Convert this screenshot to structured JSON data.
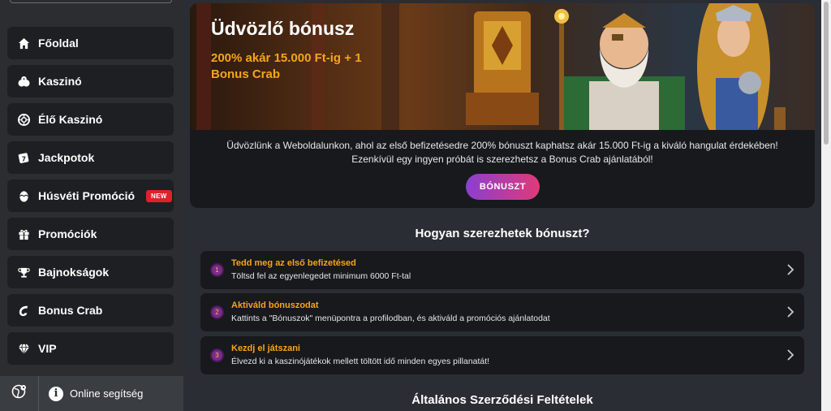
{
  "sidebar": {
    "items": [
      {
        "label": "Főoldal",
        "icon": "home-icon"
      },
      {
        "label": "Kaszinó",
        "icon": "dice-icon"
      },
      {
        "label": "Élő Kaszinó",
        "icon": "chip-icon"
      },
      {
        "label": "Jackpotok",
        "icon": "slot-icon"
      },
      {
        "label": "Húsvéti Promóció",
        "icon": "egg-icon",
        "badge": "NEW"
      },
      {
        "label": "Promóciók",
        "icon": "gift-icon"
      },
      {
        "label": "Bajnokságok",
        "icon": "trophy-icon"
      },
      {
        "label": "Bonus Crab",
        "icon": "crab-claw-icon"
      },
      {
        "label": "VIP",
        "icon": "diamond-icon"
      }
    ],
    "footer": {
      "help_label": "Online segítség",
      "help_icon": "info-icon",
      "lang_icon": "globe-icon"
    }
  },
  "bonus": {
    "title": "Üdvözlő bónusz",
    "subtitle": "200% akár 15.000 Ft-ig + 1 Bonus Crab",
    "description_line1": "Üdvözlünk a Weboldalunkon, ahol az első befizetésedre 200% bónuszt kaphatsz akár 15.000 Ft-ig a kiváló hangulat érdekében!",
    "description_line2": "Ezenkívül egy ingyen próbát is szerezhetsz a Bonus Crab ajánlatából!",
    "button_label": "BÓNUSZT"
  },
  "how": {
    "title": "Hogyan szerezhetek bónuszt?",
    "steps": [
      {
        "num": "1",
        "title": "Tedd meg az első befizetésed",
        "text": "Töltsd fel az egyenlegedet minimum 6000 Ft-tal"
      },
      {
        "num": "2",
        "title": "Aktiváld bónuszodat",
        "text": "Kattints a \"Bónuszok\" menüpontra a profilodban, és aktiváld a promóciós ajánlatodat"
      },
      {
        "num": "3",
        "title": "Kezdj el játszani",
        "text": "Élvezd ki a kaszinójátékok mellett töltött idő minden egyes pillanatát!"
      }
    ]
  },
  "terms": {
    "title": "Általános Szerződési Feltételek"
  },
  "colors": {
    "accent_orange": "#f6a51a",
    "button_gradient_start": "#8a3fd0",
    "button_gradient_end": "#e03a78",
    "new_badge": "#e0202a"
  }
}
